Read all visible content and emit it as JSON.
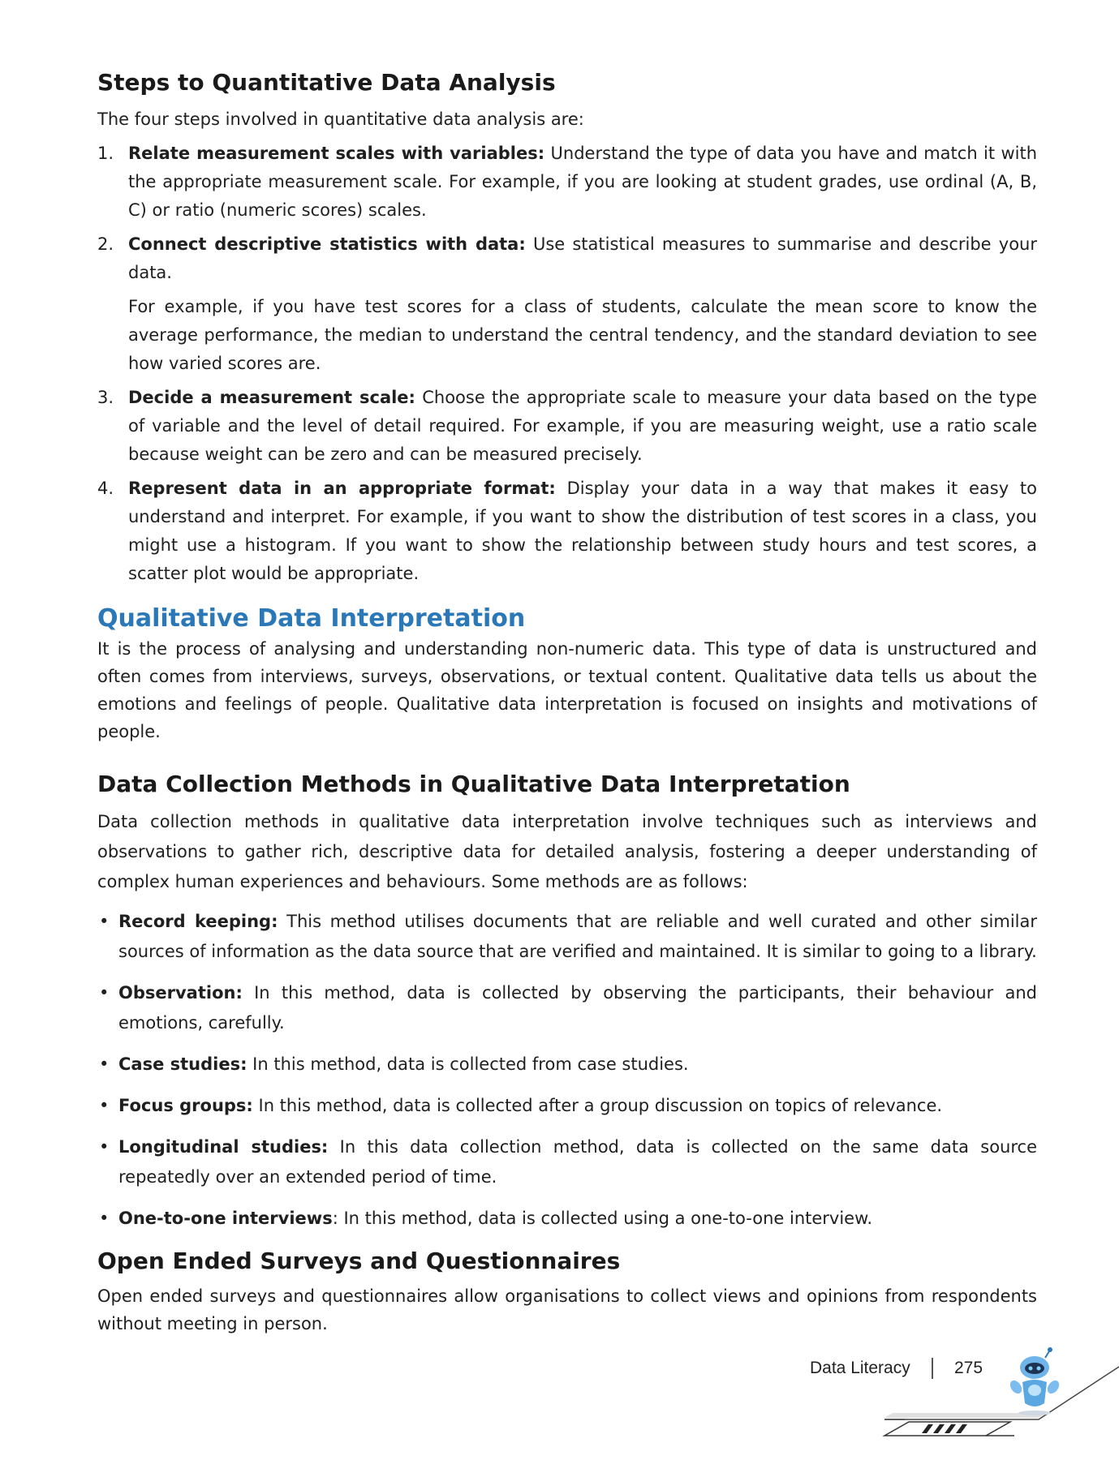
{
  "section1": {
    "heading": "Steps to Quantitative Data Analysis",
    "intro": "The four steps involved in quantitative data analysis are:",
    "steps": [
      {
        "num": "1.",
        "title": "Relate measurement scales with variables:",
        "text": " Understand the type of data you have and match it with the appropriate measurement scale. For example, if you are looking at student grades, use ordinal (A, B, C) or ratio (numeric scores) scales."
      },
      {
        "num": "2.",
        "title": "Connect descriptive statistics with data:",
        "text": " Use statistical measures to summarise and describe your data.",
        "extra": "For example, if you have test scores for a class of students, calculate the mean score to know the average performance, the median to understand the central tendency, and the standard deviation to see how varied scores are."
      },
      {
        "num": "3.",
        "title": "Decide a measurement scale:",
        "text": " Choose the appropriate scale to measure your data based on the type of variable and the level of detail required. For example, if you are measuring weight, use a ratio scale because weight can be zero and can be measured precisely."
      },
      {
        "num": "4.",
        "title": "Represent data in an appropriate format:",
        "text": " Display your data in a way that makes it easy to understand and interpret. For example, if you want to show the distribution of test scores in a class, you might use a histogram. If you want to show the relationship between study hours and test scores, a scatter plot would be appropriate."
      }
    ]
  },
  "section2": {
    "heading": "Qualitative Data Interpretation",
    "body": "It is the process of analysing and understanding non-numeric data. This type of data is unstructured and often comes from interviews, surveys, observations, or textual content. Qualitative data tells us about the emotions and feelings of people. Qualitative data interpretation is focused on insights and motivations of people."
  },
  "section3": {
    "heading": "Data Collection Methods in Qualitative Data Interpretation",
    "body": "Data collection methods in qualitative data interpretation involve techniques such as interviews and observations to gather rich, descriptive data for detailed analysis, fostering a deeper understanding of complex human experiences and behaviours. Some methods are as follows:",
    "bullet": "•",
    "methods": [
      {
        "title": "Record keeping:",
        "text": " This method utilises documents that are reliable and well curated and other similar sources of information as the data source that are verified and maintained. It is similar to going to a library."
      },
      {
        "title": "Observation:",
        "text": " In this method, data is collected by observing the participants, their behaviour and emotions, carefully."
      },
      {
        "title": "Case studies:",
        "text": " In this method, data is collected from case studies."
      },
      {
        "title": "Focus groups:",
        "text": " In this method, data is collected after a group discussion on topics of relevance."
      },
      {
        "title": "Longitudinal studies:",
        "text": " In this data collection method, data is collected on the same data source repeatedly over an extended period of time."
      },
      {
        "title": "One-to-one interviews",
        "text": ": In this method, data is collected using a one-to-one interview."
      }
    ]
  },
  "section4": {
    "heading": "Open Ended Surveys and Questionnaires",
    "body": "Open ended surveys and questionnaires allow organisations to collect views and opinions from respondents without meeting in person."
  },
  "footer": {
    "label": "Data Literacy",
    "page": "275",
    "mascot_icon": "robot-mascot-icon",
    "accent_color": "#2a78b8"
  }
}
